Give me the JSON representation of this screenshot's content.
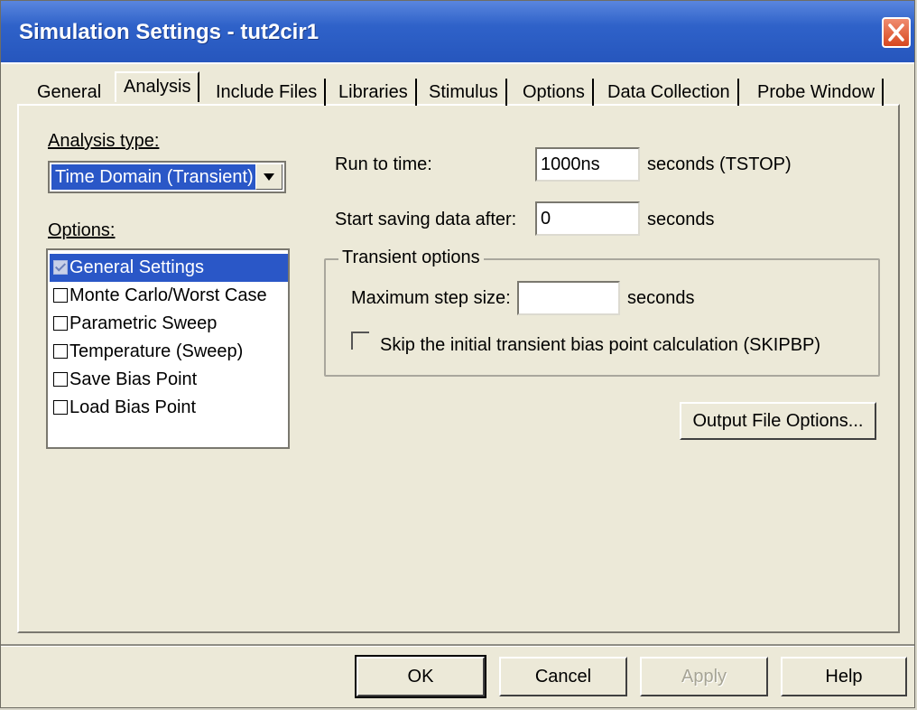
{
  "window": {
    "title": "Simulation Settings - tut2cir1"
  },
  "tabs": [
    {
      "label": "General"
    },
    {
      "label": "Analysis"
    },
    {
      "label": "Include Files"
    },
    {
      "label": "Libraries"
    },
    {
      "label": "Stimulus"
    },
    {
      "label": "Options"
    },
    {
      "label": "Data Collection"
    },
    {
      "label": "Probe Window"
    }
  ],
  "analysis": {
    "type_label": "Analysis type:",
    "type_value": "Time Domain (Transient)",
    "options_label": "Options:",
    "options": [
      {
        "label": "General Settings",
        "checked": true,
        "selected": true
      },
      {
        "label": "Monte Carlo/Worst Case",
        "checked": false
      },
      {
        "label": "Parametric Sweep",
        "checked": false
      },
      {
        "label": "Temperature (Sweep)",
        "checked": false
      },
      {
        "label": "Save Bias Point",
        "checked": false
      },
      {
        "label": "Load Bias Point",
        "checked": false
      }
    ]
  },
  "run": {
    "run_label": "Run to time:",
    "run_value": "1000ns",
    "run_unit": "seconds  (TSTOP)",
    "start_label": "Start saving data after:",
    "start_value": "0",
    "start_unit": "seconds"
  },
  "transient": {
    "group_title": "Transient options",
    "max_step_label": "Maximum step size:",
    "max_step_value": "",
    "max_step_unit": "seconds",
    "skip_label": "Skip the initial transient bias point calculation  (SKIPBP)",
    "skip_checked": false
  },
  "buttons": {
    "output_file_options": "Output File Options...",
    "ok": "OK",
    "cancel": "Cancel",
    "apply": "Apply",
    "help": "Help"
  },
  "colors": {
    "titlebar": "#2f62c9",
    "selection": "#2a57c7",
    "dialog": "#ece9d8"
  }
}
